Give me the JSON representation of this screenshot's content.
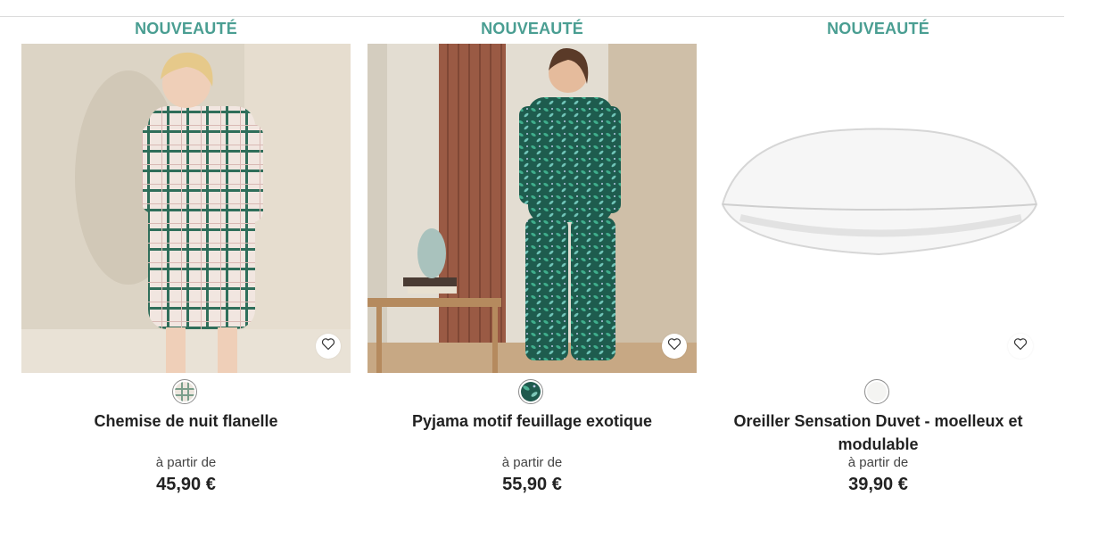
{
  "products": [
    {
      "badge": "NOUVEAUTÉ",
      "name": "Chemise de nuit flanelle",
      "from_label": "à partir de",
      "price": "45,90 €",
      "swatch_color": "#7a9e8a"
    },
    {
      "badge": "NOUVEAUTÉ",
      "name": "Pyjama motif feuillage exotique",
      "from_label": "à partir de",
      "price": "55,90 €",
      "swatch_color": "#1f5a4e"
    },
    {
      "badge": "NOUVEAUTÉ",
      "name": "Oreiller Sensation Duvet - moelleux et modulable",
      "from_label": "à partir de",
      "price": "39,90 €",
      "swatch_color": "#f4f4f2"
    }
  ],
  "colors": {
    "badge": "#4a9e92",
    "text": "#222222"
  },
  "icons": {
    "favorite": "heart-outline-icon"
  }
}
